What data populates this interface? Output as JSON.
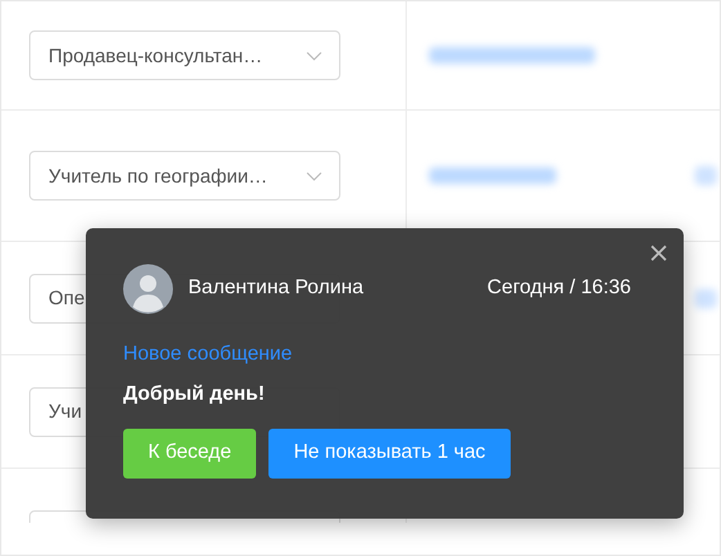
{
  "rows": [
    {
      "position": {
        "kind": "select",
        "text": "Продавец-консультан…"
      },
      "contact": {
        "kind": "blurred"
      },
      "side_blur": false
    },
    {
      "position": {
        "kind": "select",
        "text": "Учитель по географии…"
      },
      "contact": {
        "kind": "blurred"
      },
      "side_blur": true
    },
    {
      "position": {
        "kind": "select",
        "text": "Опе"
      },
      "contact": {
        "kind": "covered"
      },
      "side_blur": true
    },
    {
      "position": {
        "kind": "select",
        "text": "Учи"
      },
      "contact": {
        "kind": "covered"
      },
      "side_blur": false
    },
    {
      "position": {
        "kind": "select"
      },
      "contact": {
        "kind": "covered"
      },
      "side_blur": false
    }
  ],
  "notification": {
    "sender": "Валентина Ролина",
    "time": "Сегодня / 16:36",
    "subject": "Новое сообщение",
    "message": "Добрый день!",
    "buttons": [
      {
        "label": "К беседе",
        "kind": "primary"
      },
      {
        "label": "Не показывать 1 час",
        "kind": "secondary"
      }
    ]
  }
}
